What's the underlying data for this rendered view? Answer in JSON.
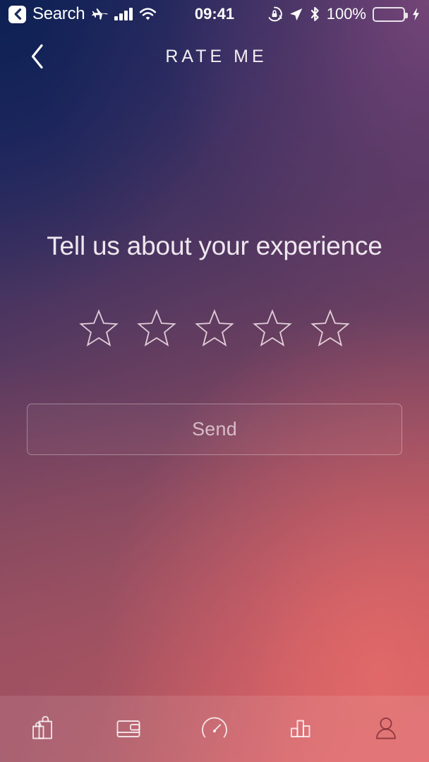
{
  "status_bar": {
    "back_chip_icon": "chevron-left-icon",
    "carrier_label": "Search",
    "airplane_icon": "airplane-mode-icon",
    "signal_icon": "cellular-signal-icon",
    "wifi_icon": "wifi-icon",
    "time": "09:41",
    "rotation_lock_icon": "rotation-lock-icon",
    "location_icon": "location-arrow-icon",
    "bluetooth_icon": "bluetooth-icon",
    "battery_percent": "100%",
    "battery_icon": "battery-full-icon",
    "charging_icon": "lightning-bolt-icon",
    "battery_color": "#46e14f",
    "text_color": "#ffffff"
  },
  "nav_bar": {
    "back_icon": "chevron-left-icon",
    "title": "RATE ME"
  },
  "main": {
    "headline": "Tell us about your experience",
    "rating": {
      "icon": "star-outline-icon",
      "count": 5,
      "selected": 0,
      "stars": [
        {
          "index": 1,
          "filled": false
        },
        {
          "index": 2,
          "filled": false
        },
        {
          "index": 3,
          "filled": false
        },
        {
          "index": 4,
          "filled": false
        },
        {
          "index": 5,
          "filled": false
        }
      ]
    },
    "send_button": {
      "label": "Send",
      "enabled": false
    }
  },
  "tab_bar": {
    "items": [
      {
        "name": "shop",
        "icon": "shopping-bags-icon",
        "active": false
      },
      {
        "name": "wallet",
        "icon": "wallet-icon",
        "active": false
      },
      {
        "name": "dashboard",
        "icon": "speedometer-icon",
        "active": false
      },
      {
        "name": "stats",
        "icon": "bar-chart-icon",
        "active": false
      },
      {
        "name": "profile",
        "icon": "person-icon",
        "active": true
      }
    ]
  },
  "theme": {
    "gradient_top_left": "#16255c",
    "gradient_top_right": "#5d3e63",
    "gradient_bottom_left": "#9d5061",
    "gradient_bottom_right": "#db6068",
    "text_primary": "#efe7ef",
    "text_muted": "rgba(245,230,235,0.72)",
    "icon_stroke": "rgba(255,255,255,0.82)",
    "icon_stroke_active": "rgba(120,40,48,0.72)"
  }
}
